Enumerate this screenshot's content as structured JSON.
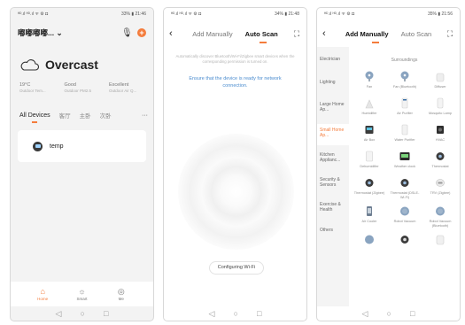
{
  "screen1": {
    "status_left": "ᴴᴰ.ıl ᴴᴰ.ıl ᯤ ⚙ ◘",
    "status_right": "33% ▮ 21:46",
    "home_title": "嘟嘟嘟嘟... ⌄",
    "weather": "Overcast",
    "stats": [
      {
        "value": "19°C",
        "label": "Outdoor Tem..."
      },
      {
        "value": "Good",
        "label": "Outdoor PM2.5"
      },
      {
        "value": "Excellent",
        "label": "Outdoor Air Q..."
      }
    ],
    "tabs": [
      "All Devices",
      "客厅",
      "主卧",
      "次卧"
    ],
    "more": "···",
    "device_name": "temp",
    "bottom_nav": [
      {
        "icon": "home-icon",
        "glyph": "⌂",
        "label": "Home"
      },
      {
        "icon": "scene-icon",
        "glyph": "☼",
        "label": "Smart"
      },
      {
        "icon": "me-icon",
        "glyph": "◎",
        "label": "Me"
      }
    ],
    "accent": "#f47c3c"
  },
  "screen2": {
    "status_left": "ᴴᴰ.ıl ᴴᴰ.ıl ᯤ ⚙ ◘",
    "status_right": "34% ▮ 21:48",
    "tab_manual": "Add Manually",
    "tab_auto": "Auto Scan",
    "note": "Automatically discover Bluetooth/Wi-Fi/Zigbee smart devices when the corresponding permission is turned on.",
    "ensure": "Ensure that the device is ready for network connection.",
    "config_button": "Configuring Wi-Fi",
    "link_color": "#4b8ccf"
  },
  "screen3": {
    "status_left": "ᴴᴰ.ıl ᴴᴰ.ıl ᯤ ⚙ ◘",
    "status_right": "35% ▮ 21:56",
    "tab_manual": "Add Manually",
    "tab_auto": "Auto Scan",
    "categories": [
      "Electrician",
      "Lighting",
      "Large Home Ap...",
      "Small Home Ap...",
      "Kitchen Applianc...",
      "Security & Sensors",
      "Exercise & Health",
      "Others"
    ],
    "active_category": "Small Home Ap...",
    "section": "Surroundings",
    "items": [
      {
        "label": "Fan",
        "icon": "fan-icon"
      },
      {
        "label": "Fan (Bluetooth)",
        "icon": "fan-icon"
      },
      {
        "label": "Diffuser",
        "icon": "diffuser-icon"
      },
      {
        "label": "Humidifier",
        "icon": "humidifier-icon"
      },
      {
        "label": "Air Purifier",
        "icon": "air-purifier-icon"
      },
      {
        "label": "Mosquito Lamp",
        "icon": "mosquito-lamp-icon"
      },
      {
        "label": "Air Box",
        "icon": "air-box-icon"
      },
      {
        "label": "Water Purifier",
        "icon": "water-purifier-icon"
      },
      {
        "label": "HVAC",
        "icon": "hvac-icon"
      },
      {
        "label": "Dehumidifier",
        "icon": "dehumidifier-icon"
      },
      {
        "label": "Weather clock",
        "icon": "weather-clock-icon"
      },
      {
        "label": "Thermostat",
        "icon": "thermostat-icon"
      },
      {
        "label": "Thermostat (Zigbee)",
        "icon": "thermostat-icon"
      },
      {
        "label": "Thermostat (DSLE-Wi-Fi)",
        "icon": "thermostat-icon"
      },
      {
        "label": "TRV (Zigbee)",
        "icon": "trv-icon"
      },
      {
        "label": "Air Cooler",
        "icon": "air-cooler-icon"
      },
      {
        "label": "Robot Vacuum",
        "icon": "robot-vacuum-icon"
      },
      {
        "label": "Robot Vacuum (Bluetooth)",
        "icon": "robot-vacuum-icon"
      }
    ]
  }
}
